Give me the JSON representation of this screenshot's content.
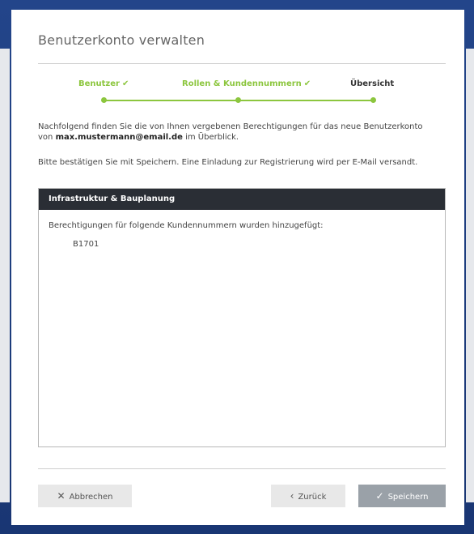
{
  "modal": {
    "title": "Benutzerkonto verwalten"
  },
  "stepper": {
    "steps": [
      {
        "label": "Benutzer",
        "state": "done"
      },
      {
        "label": "Rollen & Kundennummern",
        "state": "done"
      },
      {
        "label": "Übersicht",
        "state": "current"
      }
    ],
    "check_glyph": "✔",
    "done_color": "#8cc63e"
  },
  "intro": {
    "text_before": "Nachfolgend finden Sie die von Ihnen vergebenen Berechtigungen für das neue Benutzerkonto von ",
    "email": "max.mustermann@email.de",
    "text_after": " im Überblick."
  },
  "confirm_text": "Bitte bestätigen Sie mit Speichern. Eine Einladung zur Registrierung wird per E-Mail versandt.",
  "panel": {
    "header": "Infrastruktur & Bauplanung",
    "text": "Berechtigungen für folgende Kundennummern wurden hinzugefügt:",
    "items": [
      "B1701"
    ]
  },
  "buttons": {
    "cancel_label": "Abbrechen",
    "cancel_icon": "close-icon",
    "back_label": "Zurück",
    "back_icon": "chevron-left-icon",
    "save_label": "Speichern",
    "save_icon": "check-icon"
  }
}
